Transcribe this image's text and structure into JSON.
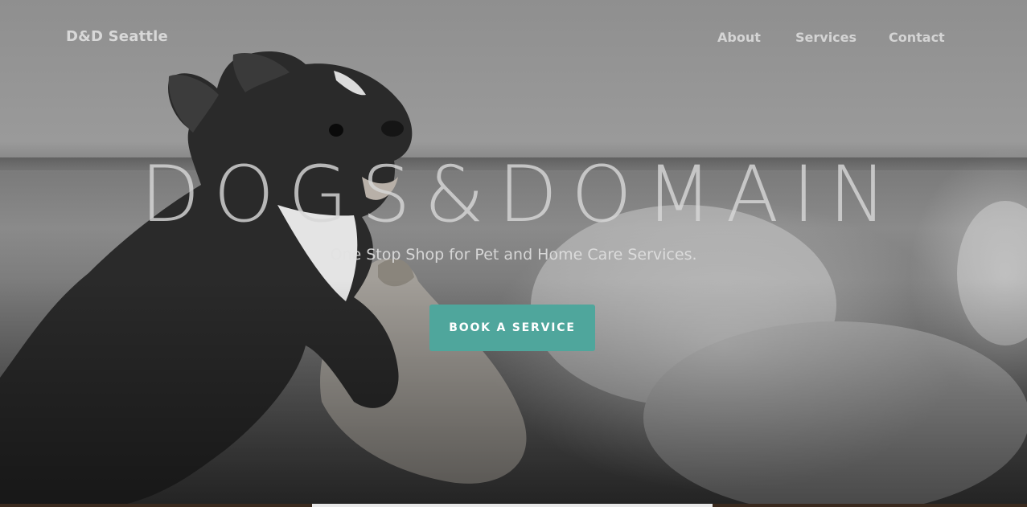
{
  "nav": {
    "brand": "D&D Seattle",
    "links": [
      {
        "label": "About"
      },
      {
        "label": "Services"
      },
      {
        "label": "Contact"
      }
    ]
  },
  "hero": {
    "title": "DOGS&DOMAIN",
    "subtitle": "One Stop Shop for Pet and Home Care Services.",
    "cta_label": "BOOK A SERVICE"
  },
  "colors": {
    "accent": "#4fa69c",
    "text_light": "#d8d8d8"
  }
}
